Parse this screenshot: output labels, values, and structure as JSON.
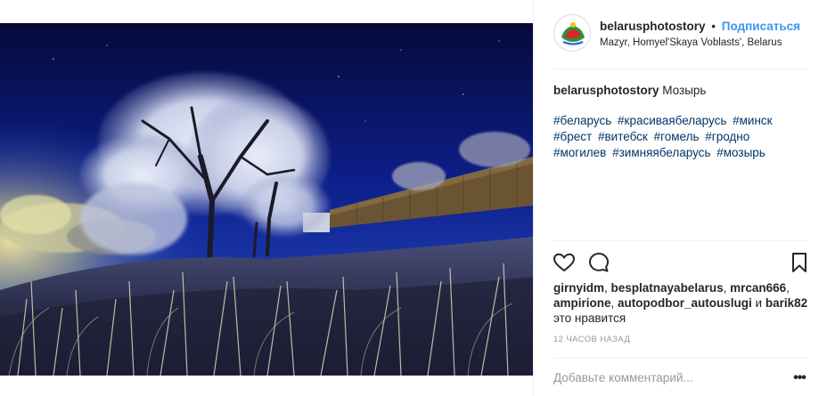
{
  "post": {
    "username": "belarusphotostory",
    "separator": "•",
    "follow_label": "Подписаться",
    "location": "Mazyr, Homyel'Skaya Voblasts', Belarus",
    "caption_user": "belarusphotostory",
    "caption_text": " Мозырь",
    "hashtags": [
      "#беларусь",
      "#красиваябеларусь",
      "#минск",
      "#брест",
      "#витебск",
      "#гомель",
      "#гродно",
      "#могилев",
      "#зимняябеларусь",
      "#мозырь"
    ],
    "likers": [
      "girnyidm",
      "besplatnayabelarus",
      "mrcan666",
      "ampirione",
      "autopodbor_autouslugi",
      "barik82"
    ],
    "likes_conj": "и",
    "likes_suffix": "это нравится",
    "timestamp": "12 часов назад",
    "comment_placeholder": "Добавьте комментарий...",
    "more_label": "•••"
  },
  "icons": {
    "like": "heart-outline-icon",
    "comment": "speech-bubble-icon",
    "save": "bookmark-icon",
    "more": "ellipsis-icon"
  },
  "colors": {
    "accent": "#3897f0",
    "hashtag": "#003569",
    "muted": "#999999",
    "sky": "#0b1a6e"
  }
}
